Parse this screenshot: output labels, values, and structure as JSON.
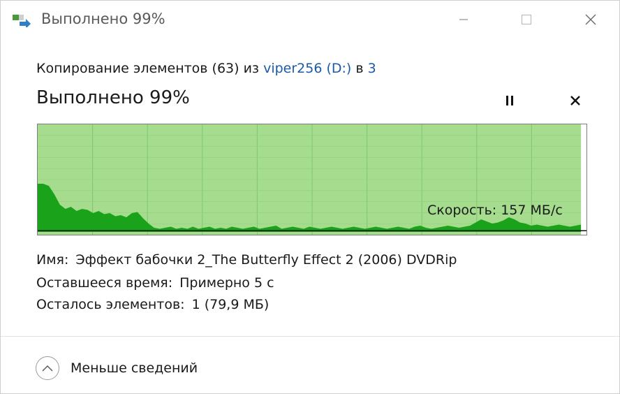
{
  "window": {
    "title": "Выполнено 99%",
    "app_icon": "copy-progress-icon",
    "controls": [
      "minimize-icon",
      "maximize-icon",
      "close-icon"
    ]
  },
  "copy_info": {
    "prefix": "Копирование элементов (63) из",
    "source": "viper256 (D:)",
    "middle": "в",
    "destination": "3"
  },
  "progress": {
    "heading": "Выполнено 99%",
    "percent": 99,
    "pause_icon": "pause-icon",
    "stop_icon": "stop-icon"
  },
  "graph": {
    "speed_label": "Скорость: 157 МБ/с",
    "progress_fraction": 0.99,
    "current_speed_fraction": 0.11,
    "speed_profile": [
      0.46,
      0.46,
      0.44,
      0.36,
      0.26,
      0.22,
      0.24,
      0.2,
      0.22,
      0.21,
      0.18,
      0.2,
      0.17,
      0.18,
      0.15,
      0.16,
      0.14,
      0.18,
      0.19,
      0.13,
      0.08,
      0.04,
      0.03,
      0.04,
      0.05,
      0.03,
      0.04,
      0.03,
      0.05,
      0.03,
      0.04,
      0.05,
      0.03,
      0.04,
      0.03,
      0.05,
      0.04,
      0.03,
      0.04,
      0.05,
      0.03,
      0.04,
      0.05,
      0.06,
      0.03,
      0.04,
      0.05,
      0.04,
      0.03,
      0.05,
      0.04,
      0.03,
      0.04,
      0.05,
      0.04,
      0.03,
      0.04,
      0.05,
      0.04,
      0.03,
      0.04,
      0.05,
      0.04,
      0.03,
      0.04,
      0.05,
      0.04,
      0.03,
      0.05,
      0.06,
      0.04,
      0.03,
      0.04,
      0.05,
      0.06,
      0.05,
      0.04,
      0.05,
      0.06,
      0.09,
      0.12,
      0.1,
      0.08,
      0.09,
      0.11,
      0.14,
      0.12,
      0.09,
      0.08,
      0.06,
      0.07,
      0.06,
      0.05,
      0.06,
      0.07,
      0.06,
      0.05,
      0.06,
      0.07
    ]
  },
  "details": {
    "name_label": "Имя:",
    "name_value": "Эффект бабочки 2_The Butterfly Effect 2 (2006) DVDRip",
    "time_label": "Оставшееся время:",
    "time_value": "Примерно 5 с",
    "items_label": "Осталось элементов:",
    "items_value": "1 (79,9 МБ)"
  },
  "footer": {
    "label": "Меньше сведений",
    "icon": "chevron-up-icon"
  }
}
